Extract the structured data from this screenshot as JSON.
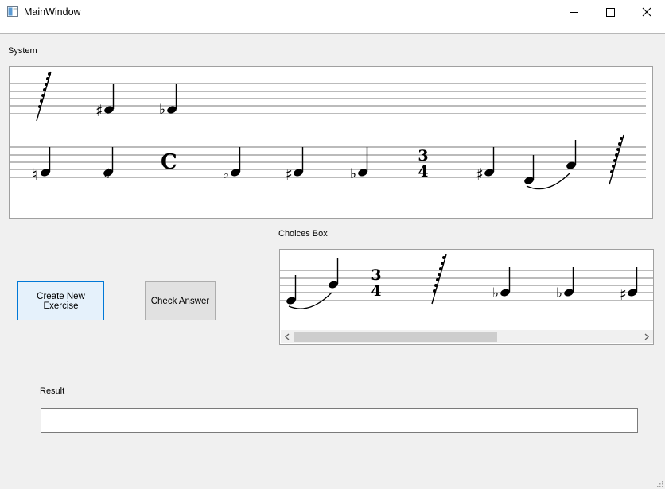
{
  "window": {
    "title": "MainWindow",
    "icon": "app-window-icon"
  },
  "system": {
    "label": "System",
    "notes": [
      "sharp-quarter-note",
      "flat-quarter-note",
      "natural-quarter-note",
      "half-flat-quarter-note",
      "common-time-symbol",
      "flat-quarter-note",
      "sharp-quarter-note",
      "flat-quarter-note",
      "time-signature-3-4",
      "sharp-quarter-note",
      "slurred-quarter-notes",
      "grace-slash-ornament"
    ],
    "time_signature": {
      "top": "3",
      "bottom": "4"
    },
    "common_time": "𝄴"
  },
  "choices": {
    "label": "Choices Box",
    "time_signature": {
      "top": "3",
      "bottom": "4"
    }
  },
  "buttons": {
    "create": "Create New Exercise",
    "check": "Check Answer"
  },
  "result": {
    "label": "Result",
    "value": ""
  },
  "colors": {
    "accent": "#0078d7",
    "window_bg": "#f0f0f0"
  }
}
